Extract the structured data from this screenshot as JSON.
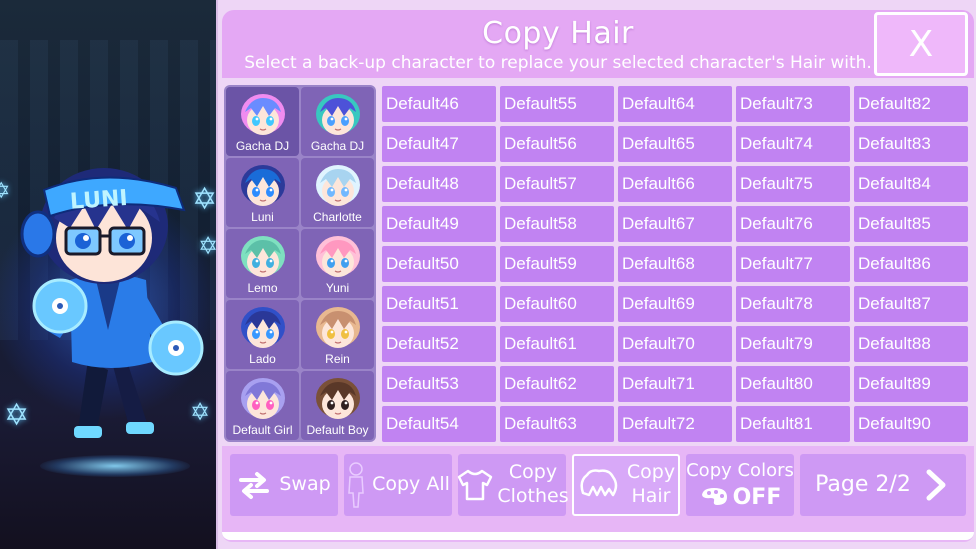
{
  "header": {
    "title": "Copy Hair",
    "subtitle": "Select a back-up character to replace your selected character's Hair with.",
    "close_label": "X"
  },
  "scene": {
    "character_label": "LUNI"
  },
  "characters": [
    {
      "name": "Gacha DJ",
      "hair": "#f08cf0",
      "hair2": "#6a8cff",
      "eyes": "#40c8ff"
    },
    {
      "name": "Gacha DJ",
      "hair": "#38c8c0",
      "hair2": "#4d52d8",
      "eyes": "#4aa0ff"
    },
    {
      "name": "Luni",
      "hair": "#2c3a9a",
      "hair2": "#1a6cd8",
      "eyes": "#2c8cff"
    },
    {
      "name": "Charlotte",
      "hair": "#e0f4ff",
      "hair2": "#a8d4f0",
      "eyes": "#70b8ff"
    },
    {
      "name": "Lemo",
      "hair": "#7ee0c0",
      "hair2": "#5cc0a8",
      "eyes": "#40b0e0"
    },
    {
      "name": "Yuni",
      "hair": "#ffc0d8",
      "hair2": "#ff98c0",
      "eyes": "#40a0f0"
    },
    {
      "name": "Lado",
      "hair": "#3050c8",
      "hair2": "#2a3898",
      "eyes": "#3898ff"
    },
    {
      "name": "Rein",
      "hair": "#e8b890",
      "hair2": "#c89070",
      "eyes": "#f0c040"
    },
    {
      "name": "Default Girl",
      "hair": "#a8a0f0",
      "hair2": "#8078d8",
      "eyes": "#ff60c0"
    },
    {
      "name": "Default Boy",
      "hair": "#7a5038",
      "hair2": "#5a3828",
      "eyes": "#302020"
    }
  ],
  "hair_grid": [
    [
      "Default46",
      "Default55",
      "Default64",
      "Default73",
      "Default82"
    ],
    [
      "Default47",
      "Default56",
      "Default65",
      "Default74",
      "Default83"
    ],
    [
      "Default48",
      "Default57",
      "Default66",
      "Default75",
      "Default84"
    ],
    [
      "Default49",
      "Default58",
      "Default67",
      "Default76",
      "Default85"
    ],
    [
      "Default50",
      "Default59",
      "Default68",
      "Default77",
      "Default86"
    ],
    [
      "Default51",
      "Default60",
      "Default69",
      "Default78",
      "Default87"
    ],
    [
      "Default52",
      "Default61",
      "Default70",
      "Default79",
      "Default88"
    ],
    [
      "Default53",
      "Default62",
      "Default71",
      "Default80",
      "Default89"
    ],
    [
      "Default54",
      "Default63",
      "Default72",
      "Default81",
      "Default90"
    ]
  ],
  "toolbar": {
    "swap": "Swap",
    "copy_all": "Copy All",
    "copy_clothes_1": "Copy",
    "copy_clothes_2": "Clothes",
    "copy_hair_1": "Copy",
    "copy_hair_2": "Hair",
    "copy_colors": "Copy Colors",
    "copy_colors_state": "OFF",
    "page": "Page 2/2"
  },
  "icons": [
    "swap-arrows-icon",
    "person-silhouette-icon",
    "shirt-icon",
    "hair-icon",
    "palette-icon",
    "chevron-right-icon"
  ],
  "colors": {
    "panel_bg": "#eed6f6",
    "header_bg": "#e4a8f4",
    "cell_bg": "#c183f2",
    "button_bg": "#ce99f4",
    "char_list_bg": "#7f64b6"
  }
}
